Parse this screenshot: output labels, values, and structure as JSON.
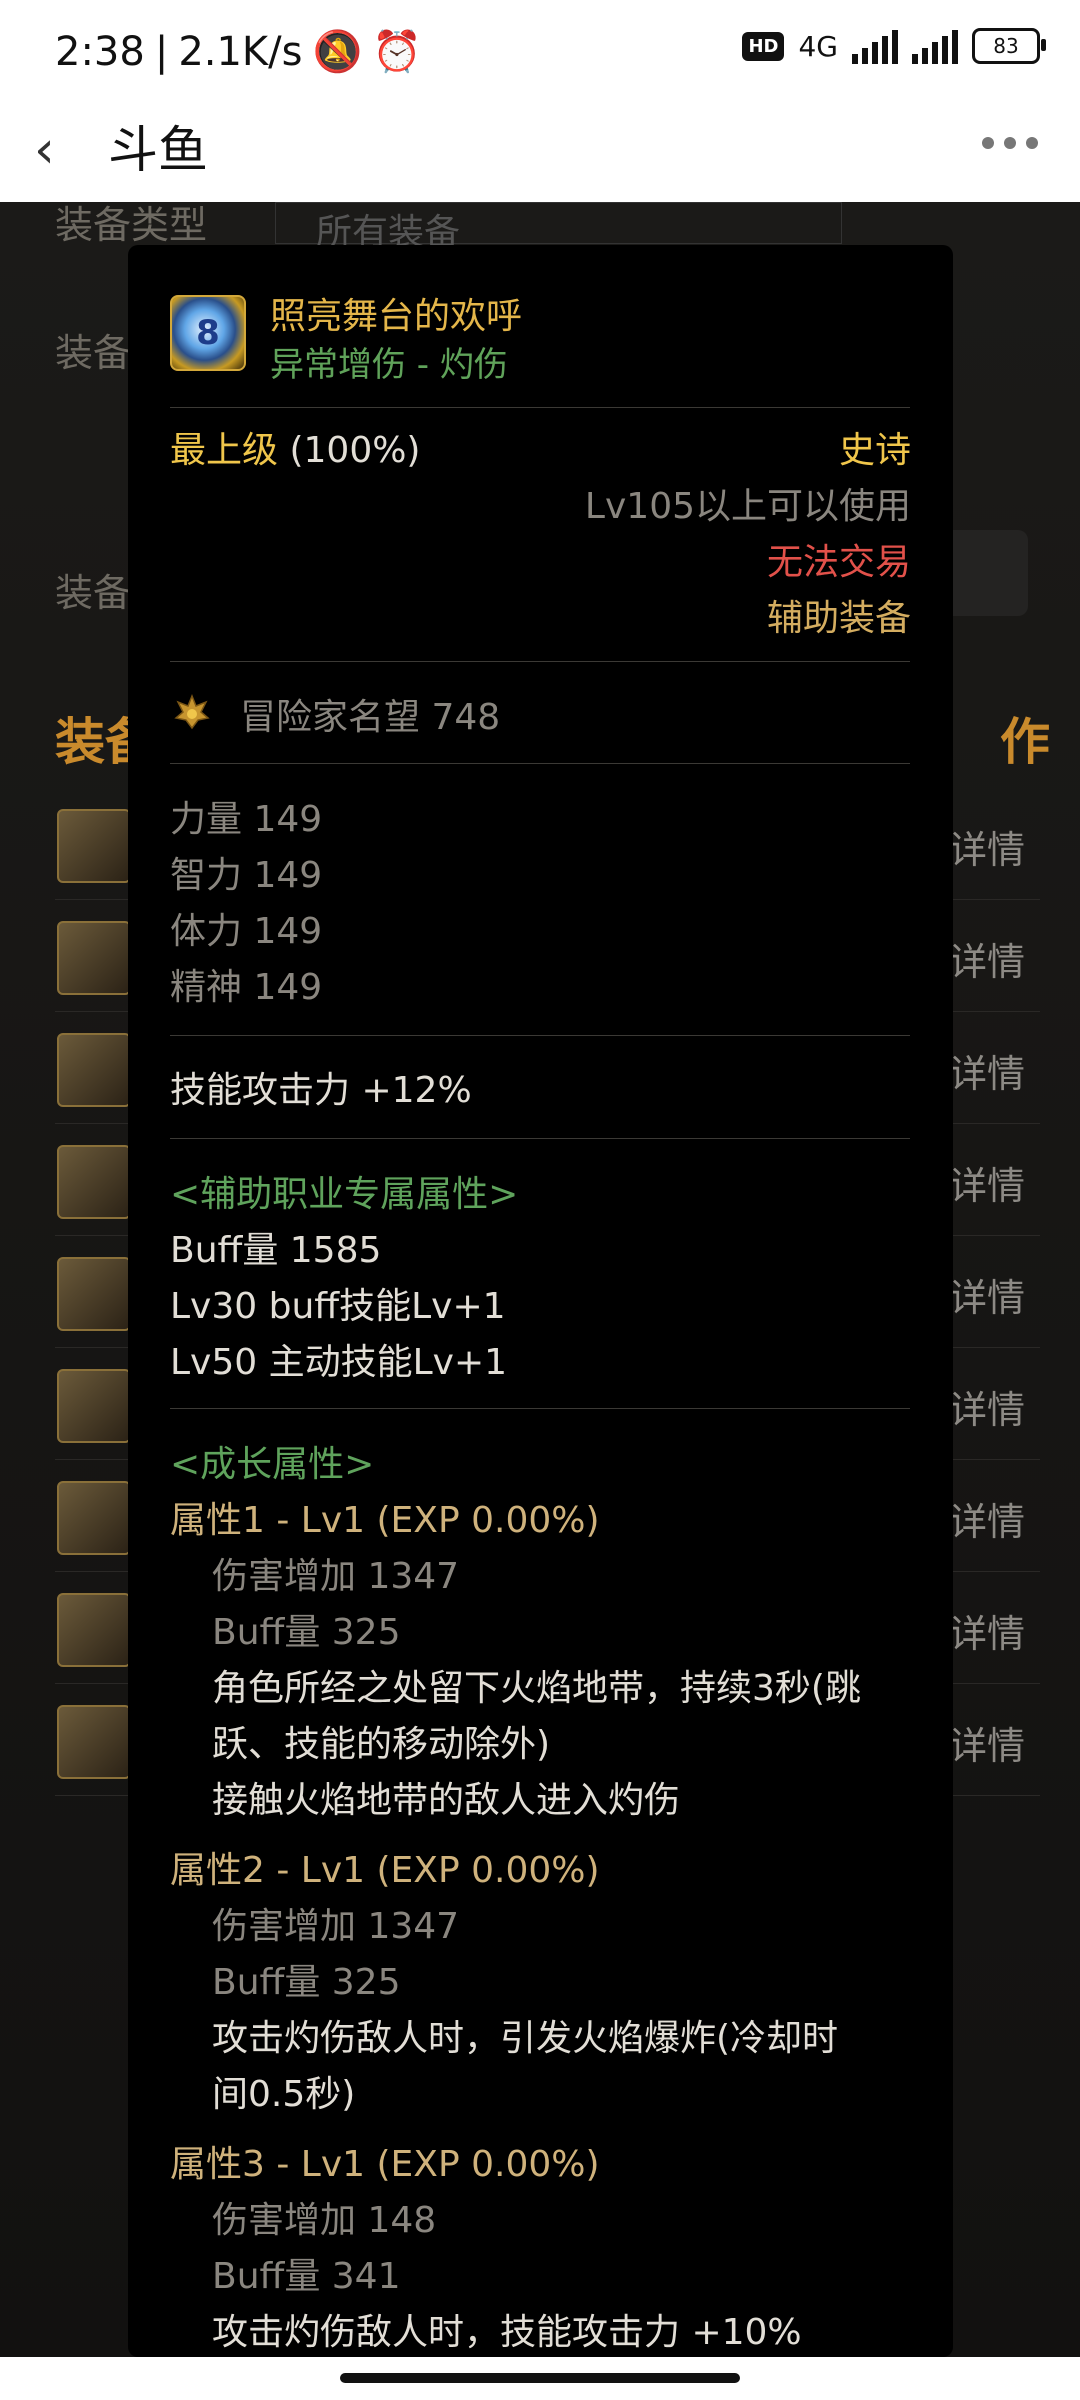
{
  "status_bar": {
    "time": "2:38",
    "speed": "2.1K/s",
    "network": "4G",
    "battery": "83"
  },
  "app_bar": {
    "title": "斗鱼"
  },
  "background_page": {
    "equip_type_label": "装备类型",
    "equip_type_value": "所有装备",
    "label_2": "装备",
    "label_3": "装备",
    "list_title": "装备",
    "list_title_right": "作",
    "detail_text": "详情"
  },
  "item": {
    "name": "照亮舞台的欢呼",
    "subtitle": "异常增伤 - 灼伤",
    "grade": "最上级",
    "grade_pct": "(100%)",
    "rarity": "史诗",
    "level_req": "Lv105以上可以使用",
    "trade": "无法交易",
    "slot": "辅助装备",
    "fame_label": "冒险家名望 748",
    "stats": [
      {
        "name": "力量",
        "value": "149"
      },
      {
        "name": "智力",
        "value": "149"
      },
      {
        "name": "体力",
        "value": "149"
      },
      {
        "name": "精神",
        "value": "149"
      }
    ],
    "skill_atk": "技能攻击力",
    "skill_atk_val": "+12%",
    "support_header": "<辅助职业专属属性>",
    "support_lines": [
      "Buff量   1585",
      "Lv30 buff技能Lv+1",
      "Lv50 主动技能Lv+1"
    ],
    "growth_header": "<成长属性>",
    "growth": [
      {
        "title": "属性1 - Lv1 (EXP 0.00%)",
        "dmg": "伤害增加   1347",
        "buff": "Buff量   325",
        "desc": [
          "角色所经之处留下火焰地带，持续3秒(跳",
          "跃、技能的移动除外)",
          "接触火焰地带的敌人进入灼伤"
        ]
      },
      {
        "title": "属性2 - Lv1 (EXP 0.00%)",
        "dmg": "伤害增加   1347",
        "buff": "Buff量   325",
        "desc": [
          "攻击灼伤敌人时，引发火焰爆炸(冷却时",
          "间0.5秒)"
        ]
      },
      {
        "title": "属性3 - Lv1 (EXP 0.00%)",
        "dmg": "伤害增加   148",
        "buff": "Buff量   341",
        "desc": [
          "攻击灼伤敌人时，技能攻击力 +10%"
        ]
      }
    ]
  },
  "colors": {
    "item_name": "#e4b64a",
    "tag_green": "#5fa35c",
    "epic": "#f0c64b",
    "untradeable": "#e2514a"
  }
}
